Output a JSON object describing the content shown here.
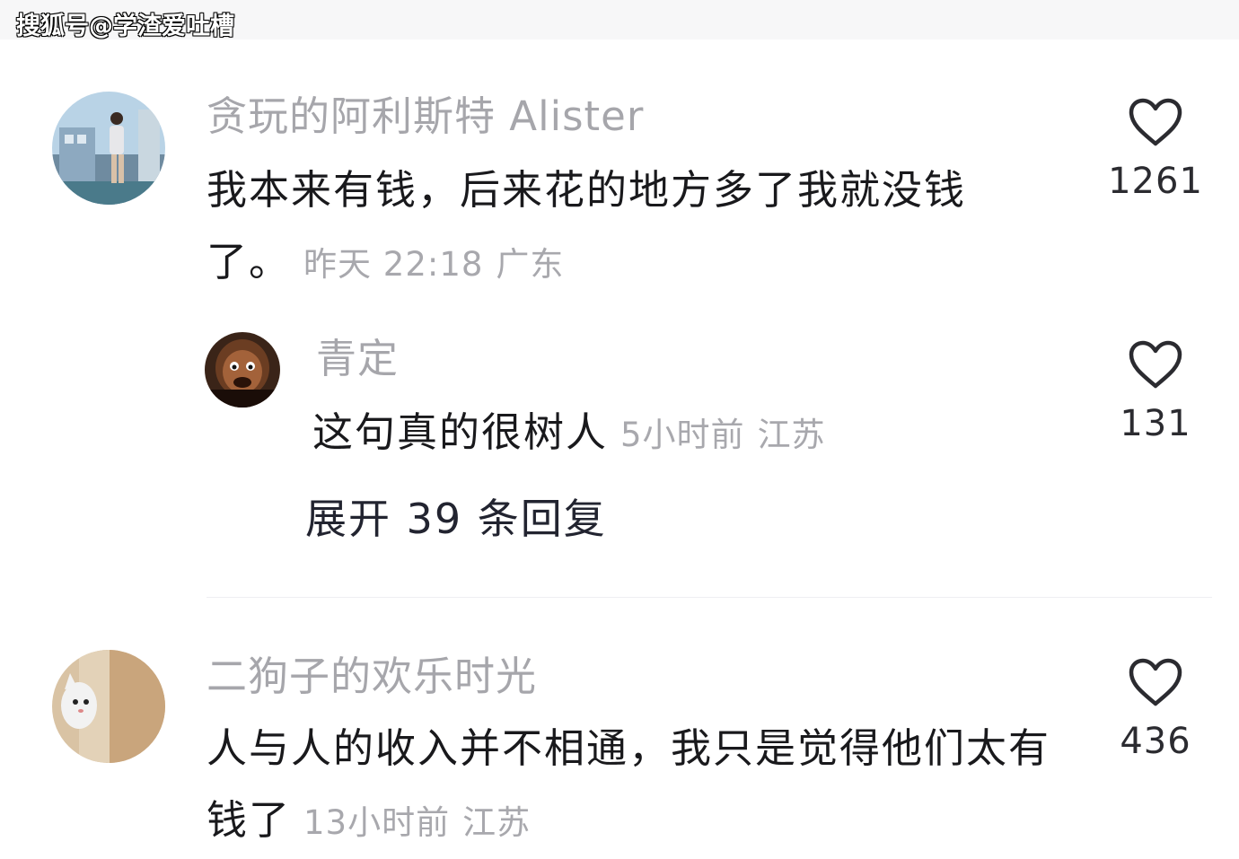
{
  "watermark": "搜狐号@学渣爱吐槽",
  "comments": [
    {
      "username": "贪玩的阿利斯特 Alister",
      "text": "我本来有钱，后来花的地方多了我就没钱了。",
      "time": "昨天 22:18",
      "location": "广东",
      "likes": "1261"
    },
    {
      "username": "青定",
      "text": "这句真的很树人",
      "time": "5小时前",
      "location": "江苏",
      "likes": "131",
      "is_reply": true
    },
    {
      "username": "二狗子的欢乐时光",
      "text": "人与人的收入并不相通，我只是觉得他们太有钱了",
      "time": "13小时前",
      "location": "江苏",
      "likes": "436"
    }
  ],
  "expand_replies": "展开 39 条回复",
  "icons": {
    "like": "heart-outline-icon"
  },
  "colors": {
    "username": "#a6a6ab",
    "text": "#19191c",
    "meta": "#a8a8ad",
    "heart_stroke": "#2b2b30"
  }
}
